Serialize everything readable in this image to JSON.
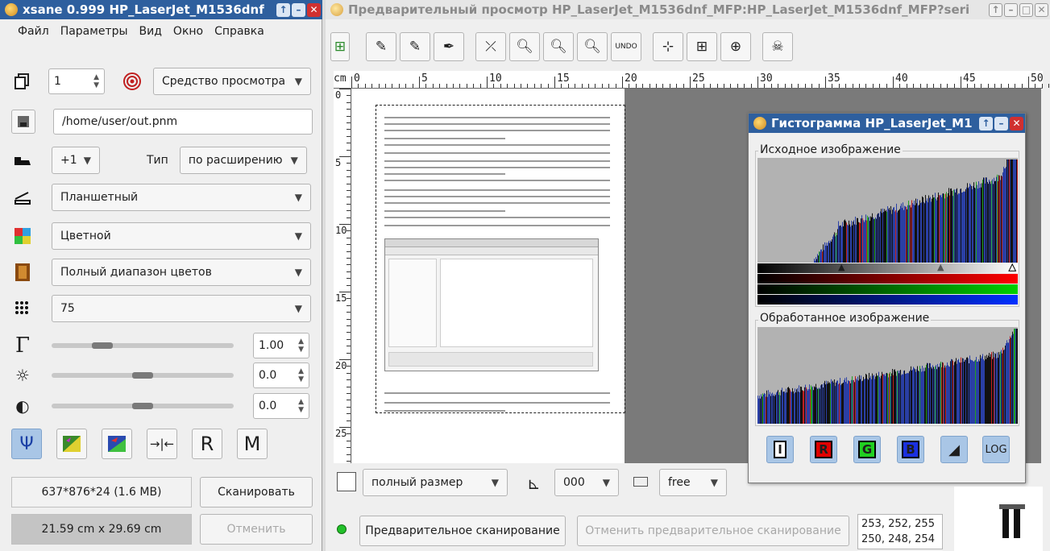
{
  "xsane": {
    "title": "xsane 0.999 HP_LaserJet_M1536dnf",
    "menu": [
      "Файл",
      "Параметры",
      "Вид",
      "Окно",
      "Справка"
    ],
    "copies": "1",
    "target": "Средство просмотра",
    "filename": "/home/user/out.pnm",
    "step": "+1",
    "type_label": "Тип",
    "type_value": "по расширению",
    "source": "Планшетный",
    "mode": "Цветной",
    "color_range": "Полный диапазон цветов",
    "resolution": "75",
    "gamma": "1.00",
    "brightness": "0.0",
    "contrast": "0.0",
    "gamma_level": 0.25,
    "brightness_level": 0.5,
    "contrast_level": 0.5,
    "tool_letters": [
      "R",
      "M"
    ],
    "image_info": "637*876*24 (1.6 MB)",
    "scan_button": "Сканировать",
    "size_info": "21.59 cm x 29.69 cm",
    "cancel_button": "Отменить"
  },
  "preview": {
    "title": "Предварительный просмотр HP_LaserJet_M1536dnf_MFP:HP_LaserJet_M1536dnf_MFP?seri",
    "ruler_unit": "cm",
    "ruler_marks": [
      "0",
      "5",
      "10",
      "15",
      "20",
      "25",
      "30",
      "35",
      "40",
      "45",
      "50"
    ],
    "vruler_marks": [
      "0",
      "5",
      "10",
      "15",
      "20",
      "25"
    ],
    "size_combo": "полный размер",
    "rotation_combo": "000",
    "ratio_combo": "free",
    "preview_scan_button": "Предварительное сканирование",
    "cancel_preview_button": "Отменить предварительное сканирование",
    "pixel_values_1": "253, 252, 255",
    "pixel_values_2": "250, 248, 254"
  },
  "histogram": {
    "title": "Гистограмма HP_LaserJet_M1",
    "source_label": "Исходное изображение",
    "processed_label": "Обработанное изображение",
    "buttons": [
      "I",
      "R",
      "G",
      "B",
      "LOG"
    ]
  },
  "colors": {
    "titlebar_active": "#2e5f9e",
    "close_button": "#d03030",
    "histogram_blue": "#2a3fa5",
    "toggle_active": "#a9c6e6"
  }
}
